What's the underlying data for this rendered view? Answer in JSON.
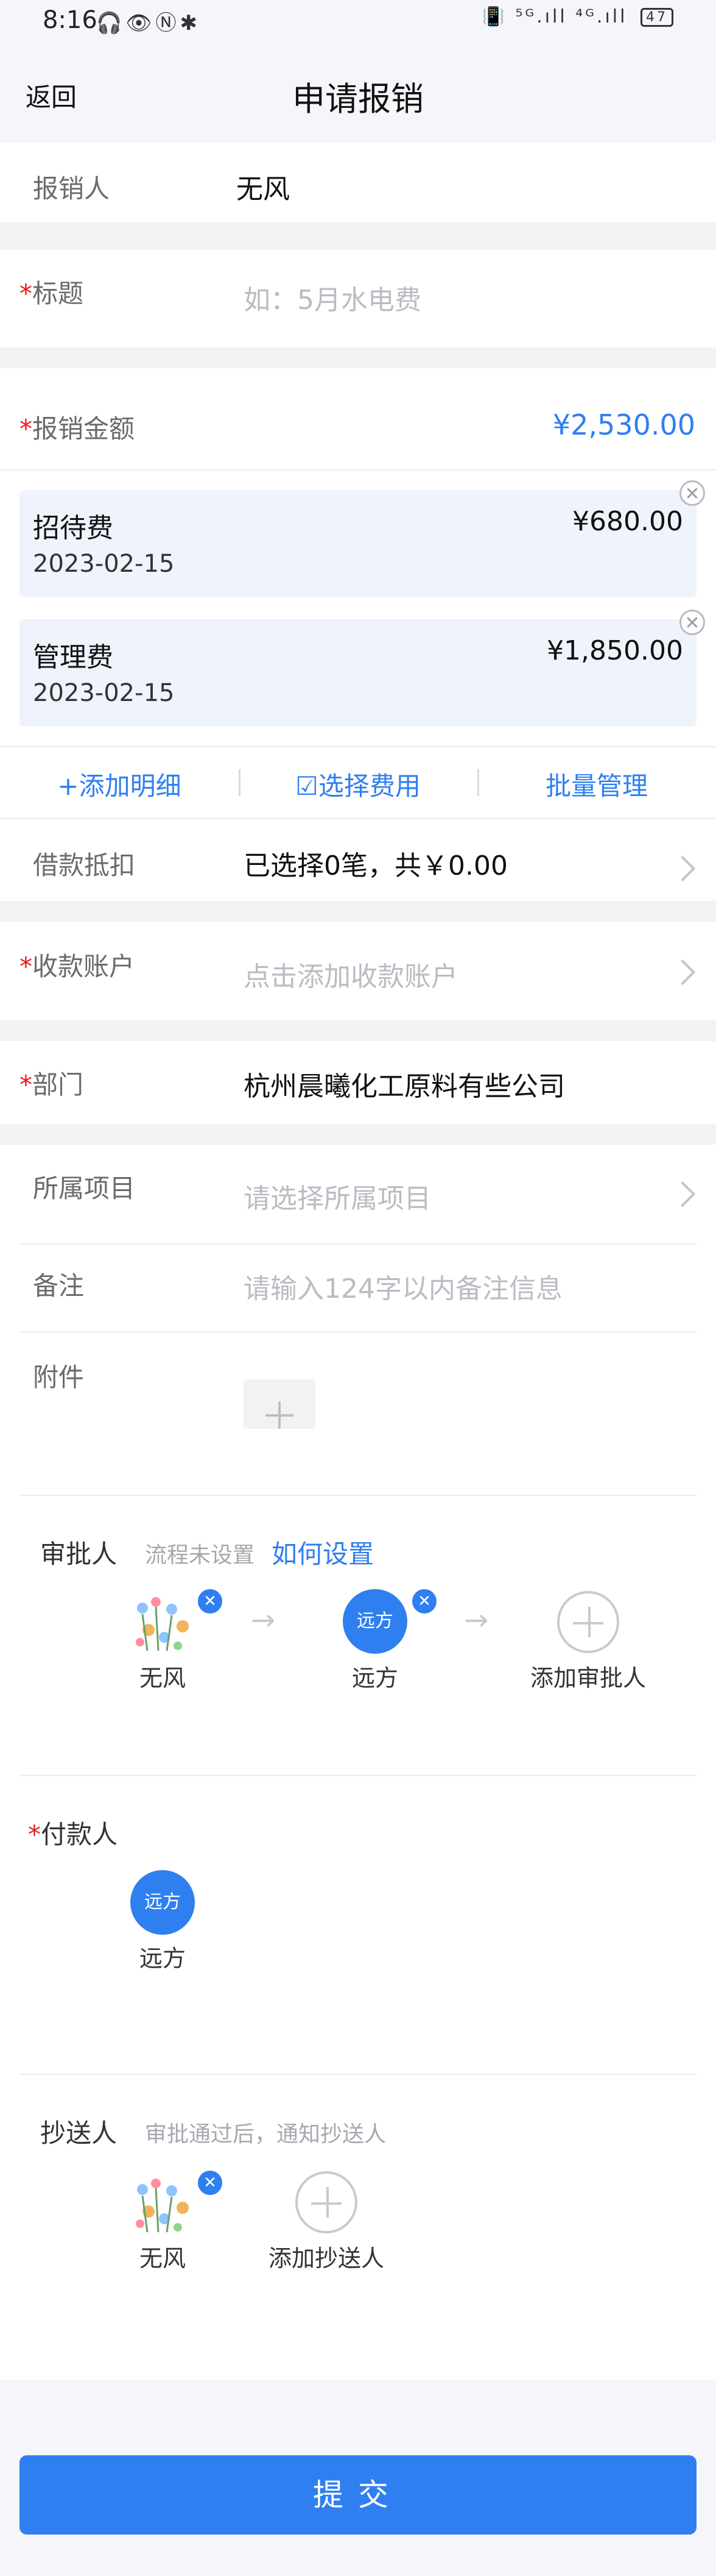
{
  "status_bar": {
    "time": "8:16",
    "left_icons": "🎧👁Ⓝ✱",
    "right_icons": "📳 ⁵ᴳ.ıll ⁴ᴳ.ıll",
    "battery": "47"
  },
  "nav": {
    "back": "返回",
    "title": "申请报销"
  },
  "submitter": {
    "label": "报销人",
    "value": "无风"
  },
  "title_field": {
    "required_mark": "*",
    "label": "标题",
    "placeholder": "如：5月水电费"
  },
  "amount": {
    "required_mark": "*",
    "label": "报销金额",
    "value": "¥2,530.00"
  },
  "expenses": [
    {
      "name": "招待费",
      "date": "2023-02-15",
      "amount": "¥680.00"
    },
    {
      "name": "管理费",
      "date": "2023-02-15",
      "amount": "¥1,850.00"
    }
  ],
  "actions": {
    "add_detail": "+添加明细",
    "select_cost": "☑选择费用",
    "batch_manage": "批量管理"
  },
  "loan_offset": {
    "label": "借款抵扣",
    "value": "已选择0笔，共￥0.00"
  },
  "payee_account": {
    "required_mark": "*",
    "label": "收款账户",
    "placeholder": "点击添加收款账户"
  },
  "department": {
    "required_mark": "*",
    "label": "部门",
    "value": "杭州晨曦化工原料有些公司"
  },
  "project": {
    "label": "所属项目",
    "placeholder": "请选择所属项目"
  },
  "remark": {
    "label": "备注",
    "placeholder": "请输入124字以内备注信息"
  },
  "attachment": {
    "label": "附件"
  },
  "approvers": {
    "label": "审批人",
    "hint": "流程未设置",
    "link": "如何设置",
    "people": [
      {
        "name": "无风",
        "avatar_text": ""
      },
      {
        "name": "远方",
        "avatar_text": "远方"
      }
    ],
    "add_label": "添加审批人"
  },
  "payer": {
    "required_mark": "*",
    "label": "付款人",
    "person": {
      "name": "远方",
      "avatar_text": "远方"
    }
  },
  "cc": {
    "label": "抄送人",
    "hint": "审批通过后，通知抄送人",
    "person": {
      "name": "无风"
    },
    "add_label": "添加抄送人"
  },
  "submit": {
    "label": "提交"
  },
  "colors": {
    "accent": "#2f7ff0",
    "required": "#e02020",
    "page_bg": "#f4f6fa",
    "expense_bg": "#eef3fc"
  }
}
